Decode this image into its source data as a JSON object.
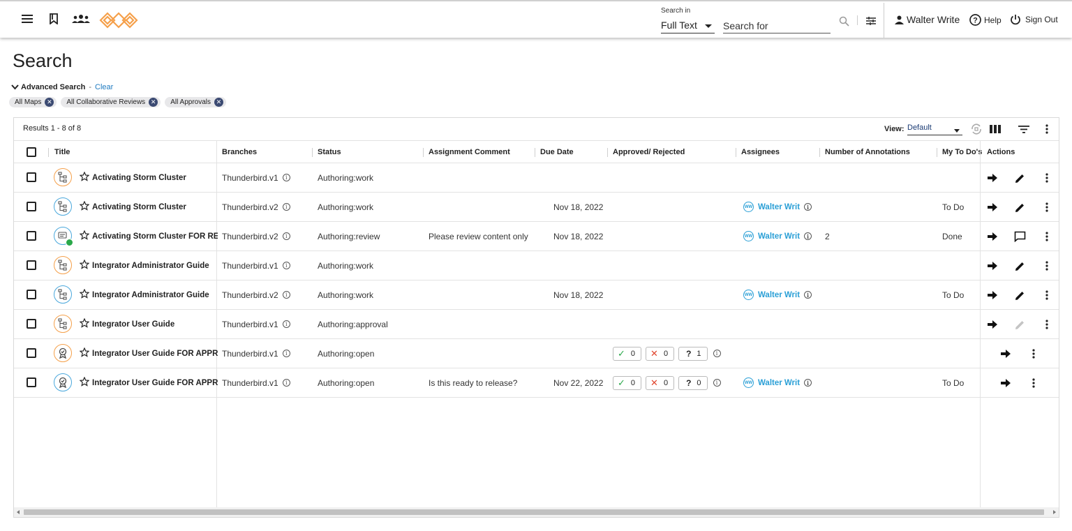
{
  "topbar": {
    "search_in_label": "Search in",
    "search_in_value": "Full Text",
    "search_placeholder": "Search for",
    "user_name": "Walter Write",
    "help_label": "Help",
    "signout_label": "Sign Out"
  },
  "page": {
    "title": "Search",
    "advanced_label": "Advanced Search",
    "dash": "-",
    "clear_label": "Clear",
    "chips": [
      "All Maps",
      "All Collaborative Reviews",
      "All Approvals"
    ]
  },
  "grid": {
    "results": "Results 1 - 8 of 8",
    "view_label": "View:",
    "view_value": "Default",
    "columns": [
      "Title",
      "Branches",
      "Status",
      "Assignment Comment",
      "Due Date",
      "Approved/ Rejected",
      "Assignees",
      "Number of Annotations",
      "My To Do's",
      "Actions"
    ],
    "rows": [
      {
        "title": "Activating Storm Cluster",
        "branch": "Thunderbird.v1",
        "status": "Authoring:work",
        "comment": "",
        "due": "",
        "assignee": "",
        "annotations": "",
        "todo": "",
        "icon": "map",
        "color": "orange"
      },
      {
        "title": "Activating Storm Cluster",
        "branch": "Thunderbird.v2",
        "status": "Authoring:work",
        "comment": "",
        "due": "Nov 18, 2022",
        "assignee": "Walter Writ",
        "annotations": "",
        "todo": "To Do",
        "icon": "map",
        "color": "blue"
      },
      {
        "title": "Activating Storm Cluster FOR RE...",
        "branch": "Thunderbird.v2",
        "status": "Authoring:review",
        "comment": "Please review content only",
        "due": "Nov 18, 2022",
        "assignee": "Walter Writ",
        "annotations": "2",
        "todo": "Done",
        "icon": "review",
        "color": "blue"
      },
      {
        "title": "Integrator Administrator Guide",
        "branch": "Thunderbird.v1",
        "status": "Authoring:work",
        "comment": "",
        "due": "",
        "assignee": "",
        "annotations": "",
        "todo": "",
        "icon": "map",
        "color": "orange"
      },
      {
        "title": "Integrator Administrator Guide",
        "branch": "Thunderbird.v2",
        "status": "Authoring:work",
        "comment": "",
        "due": "Nov 18, 2022",
        "assignee": "Walter Writ",
        "annotations": "",
        "todo": "To Do",
        "icon": "map",
        "color": "blue"
      },
      {
        "title": "Integrator User Guide",
        "branch": "Thunderbird.v1",
        "status": "Authoring:approval",
        "comment": "",
        "due": "",
        "assignee": "",
        "annotations": "",
        "todo": "",
        "icon": "map",
        "color": "orange"
      },
      {
        "title": "Integrator User Guide FOR APPR...",
        "branch": "Thunderbird.v1",
        "status": "Authoring:open",
        "comment": "",
        "due": "",
        "assignee": "",
        "annotations": "",
        "todo": "",
        "icon": "approval",
        "color": "orange",
        "approved": "0",
        "rejected": "0",
        "pending": "1"
      },
      {
        "title": "Integrator User Guide FOR APPR...",
        "branch": "Thunderbird.v1",
        "status": "Authoring:open",
        "comment": "Is this ready to release?",
        "due": "Nov 22, 2022",
        "assignee": "Walter Writ",
        "annotations": "",
        "todo": "To Do",
        "icon": "approval",
        "color": "blue",
        "approved": "0",
        "rejected": "0",
        "pending": "0"
      }
    ]
  },
  "colors": {
    "link_blue": "#1f7bc1",
    "assignee_blue": "#2a9fd6",
    "map_orange": "#f5a04a",
    "map_blue": "#4aa8dc",
    "approve_green": "#2aa84a",
    "reject_red": "#e0452e",
    "logo_orange": "#f5a04a"
  }
}
